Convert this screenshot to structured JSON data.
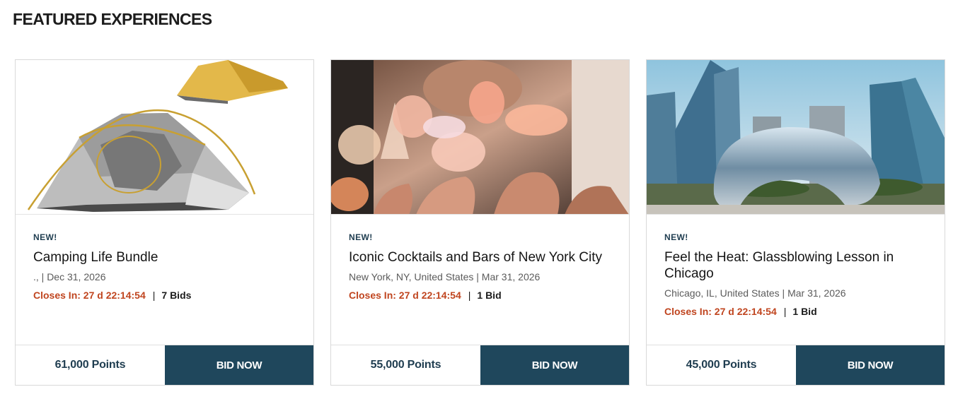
{
  "section": {
    "title": "FEATURED EXPERIENCES"
  },
  "cards": [
    {
      "badge": "NEW!",
      "title": "Camping Life Bundle",
      "meta": "., | Dec 31, 2026",
      "closes": "Closes In: 27 d 22:14:54",
      "separator": "|",
      "bids": "7 Bids",
      "points": "61,000 Points",
      "button": "BID NOW",
      "image_icon": "tent-image",
      "watch_icon": "eye-icon"
    },
    {
      "badge": "NEW!",
      "title": "Iconic Cocktails and Bars of New York City",
      "meta": "New York, NY, United States | Mar 31, 2026",
      "closes": "Closes In: 27 d 22:14:54",
      "separator": "|",
      "bids": "1 Bid",
      "points": "55,000 Points",
      "button": "BID NOW",
      "image_icon": "cocktails-image",
      "watch_icon": "eye-icon"
    },
    {
      "badge": "NEW!",
      "title": "Feel the Heat: Glassblowing Lesson in Chicago",
      "meta": "Chicago, IL, United States | Mar 31, 2026",
      "closes": "Closes In: 27 d 22:14:54",
      "separator": "|",
      "bids": "1 Bid",
      "points": "45,000 Points",
      "button": "BID NOW",
      "image_icon": "chicago-bean-image",
      "watch_icon": "eye-icon"
    }
  ],
  "colors": {
    "accent_navy": "#1f475c",
    "closes_red": "#c0451f",
    "badge_navy": "#1f3d50"
  }
}
